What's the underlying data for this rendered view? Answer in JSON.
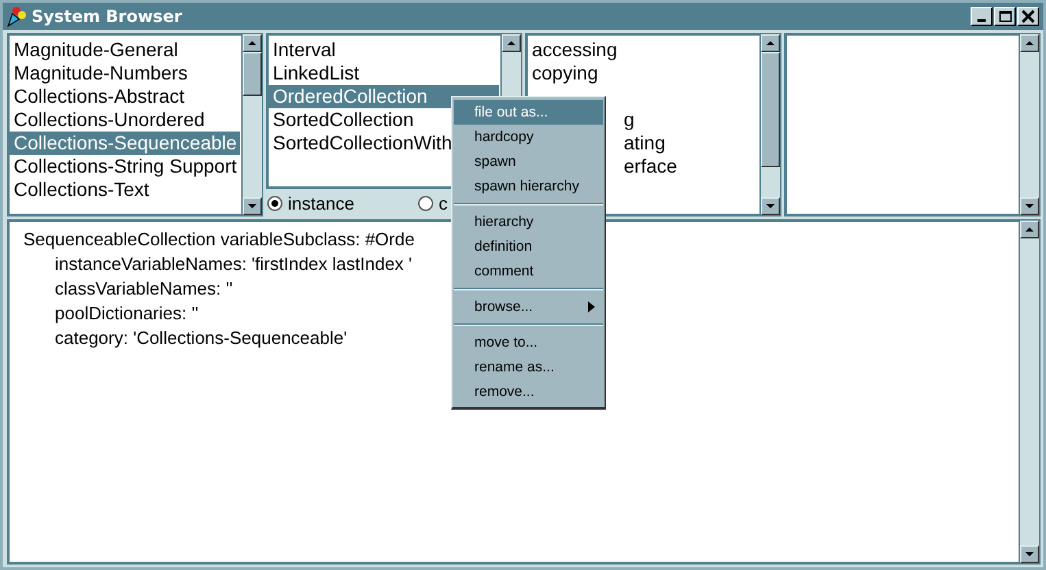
{
  "window": {
    "title": "System Browser"
  },
  "categories": {
    "items": [
      {
        "label": "Magnitude-General",
        "selected": false
      },
      {
        "label": "Magnitude-Numbers",
        "selected": false
      },
      {
        "label": "Collections-Abstract",
        "selected": false
      },
      {
        "label": "Collections-Unordered",
        "selected": false
      },
      {
        "label": "Collections-Sequenceable",
        "selected": true
      },
      {
        "label": "Collections-String Support",
        "selected": false
      },
      {
        "label": "Collections-Text",
        "selected": false
      }
    ]
  },
  "classes": {
    "items": [
      {
        "label": "Interval",
        "selected": false
      },
      {
        "label": "LinkedList",
        "selected": false
      },
      {
        "label": "OrderedCollection",
        "selected": true
      },
      {
        "label": "SortedCollection",
        "selected": false
      },
      {
        "label": "SortedCollectionWith",
        "selected": false
      }
    ],
    "radios": [
      {
        "label": "instance",
        "selected": true
      },
      {
        "label": "c",
        "selected": false
      }
    ]
  },
  "protocols": {
    "items": [
      {
        "label": "accessing",
        "kind": "full"
      },
      {
        "label": "copying",
        "kind": "full"
      },
      {
        "label": "g",
        "kind": "partial-gap"
      },
      {
        "label": "ating",
        "kind": "partial"
      },
      {
        "label": "erface",
        "kind": "partial"
      }
    ]
  },
  "code": {
    "lines": [
      {
        "text": "SequenceableCollection variableSubclass: #Orde",
        "kind": "head"
      },
      {
        "text": "instanceVariableNames: 'firstIndex lastIndex '",
        "kind": "indent"
      },
      {
        "text": "classVariableNames: ''",
        "kind": "indent"
      },
      {
        "text": "poolDictionaries: ''",
        "kind": "indent"
      },
      {
        "text": "category: 'Collections-Sequenceable'",
        "kind": "indent"
      }
    ]
  },
  "menu": {
    "groups": [
      [
        {
          "label": "file out as...",
          "selected": true
        },
        {
          "label": "hardcopy",
          "selected": false
        },
        {
          "label": "spawn",
          "selected": false
        },
        {
          "label": "spawn hierarchy",
          "selected": false
        }
      ],
      [
        {
          "label": "hierarchy",
          "selected": false
        },
        {
          "label": "definition",
          "selected": false
        },
        {
          "label": "comment",
          "selected": false
        }
      ],
      [
        {
          "label": "browse...",
          "selected": false,
          "submenu": true
        }
      ],
      [
        {
          "label": "move to...",
          "selected": false
        },
        {
          "label": "rename as...",
          "selected": false
        },
        {
          "label": "remove...",
          "selected": false
        }
      ]
    ]
  }
}
